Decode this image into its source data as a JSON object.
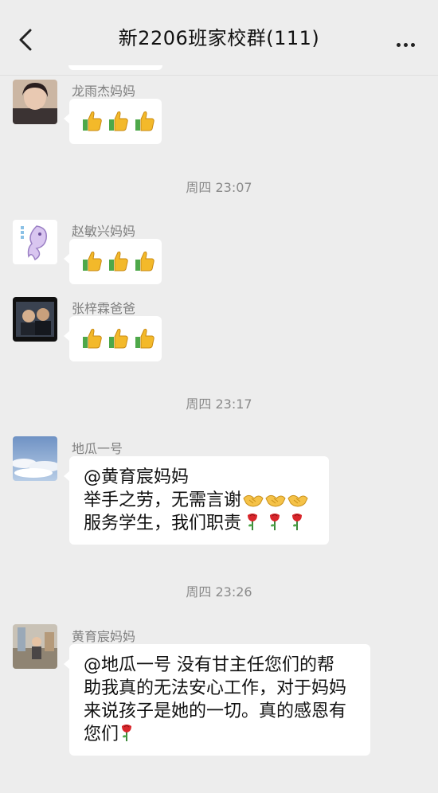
{
  "header": {
    "title": "新2206班家校群(111)",
    "back_icon": "chevron-left-icon",
    "more_icon": "more-dots-icon"
  },
  "messages": [
    {
      "sender": "龙雨杰妈妈",
      "content": [
        "👍",
        "👍",
        "👍"
      ]
    },
    {
      "timestamp": "周四 23:07"
    },
    {
      "sender": "赵敏兴妈妈",
      "content": [
        "👍",
        "👍",
        "👍"
      ]
    },
    {
      "sender": "张梓霖爸爸",
      "content": [
        "👍",
        "👍",
        "👍"
      ]
    },
    {
      "timestamp": "周四 23:17"
    },
    {
      "sender": "地瓜一号",
      "lines": [
        "@黄育宸妈妈",
        "举手之劳，无需言谢🤝🤝🤝",
        "服务学生，我们职责🌹🌹🌹"
      ]
    },
    {
      "timestamp": "周四 23:26"
    },
    {
      "sender": "黄育宸妈妈",
      "lines": [
        "@地瓜一号  没有甘主任您们的帮",
        "助我真的无法安心工作，对于妈妈",
        "来说孩子是她的一切。真的感恩有",
        "您们🌹"
      ]
    }
  ],
  "ui": {
    "thumbs_text": "👍👍👍",
    "msg1_text": {
      "l1": "@黄育宸妈妈",
      "l2": "举手之劳，无需言谢",
      "l3": "服务学生，我们职责"
    },
    "msg2_text": {
      "l1": "@地瓜一号  没有甘主任您们的帮",
      "l2": "助我真的无法安心工作，对于妈妈",
      "l3": "来说孩子是她的一切。真的感恩有",
      "l4": "您们"
    }
  },
  "colors": {
    "background": "#ededed",
    "bubble": "#ffffff",
    "sender_name": "#808080",
    "timestamp": "#8a8a8a"
  }
}
